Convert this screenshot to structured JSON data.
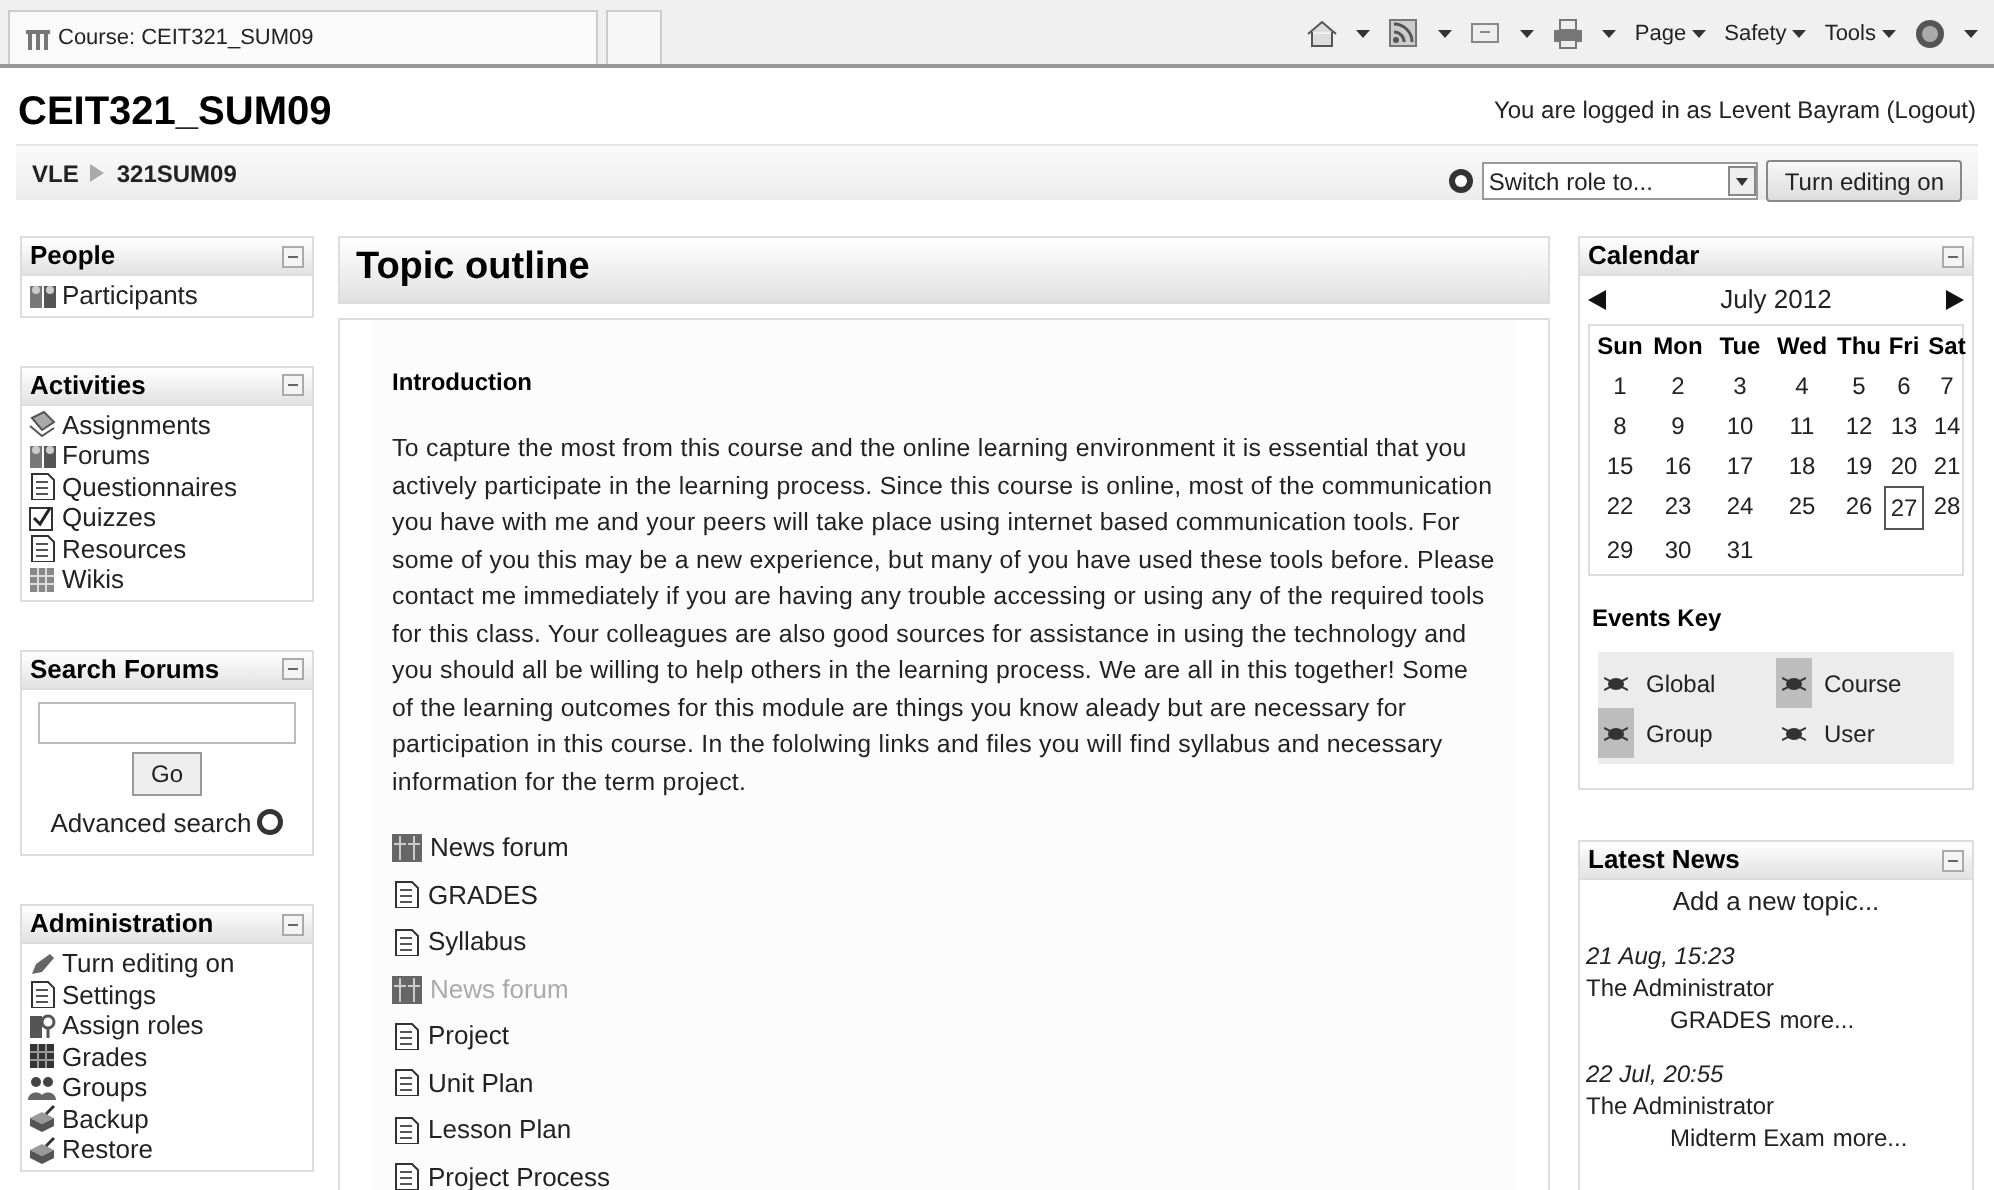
{
  "browser": {
    "tab_title": "Course: CEIT321_SUM09",
    "menus": [
      "Page",
      "Safety",
      "Tools"
    ]
  },
  "header": {
    "title": "CEIT321_SUM09",
    "login_text": "You are logged in as Levent Bayram",
    "logout": "(Logout)"
  },
  "breadcrumb": {
    "items": [
      "VLE",
      "321SUM09"
    ],
    "switch_role": {
      "value": "Switch role to..."
    },
    "edit_button": "Turn editing on"
  },
  "left_blocks": [
    {
      "kind": "links",
      "title": "People",
      "items": [
        "Participants"
      ]
    },
    {
      "kind": "links",
      "title": "Activities",
      "items": [
        "Assignments",
        "Forums",
        "Questionnaires",
        "Quizzes",
        "Resources",
        "Wikis"
      ]
    },
    {
      "kind": "search",
      "title": "Search Forums",
      "button": "Go",
      "link": "Advanced search"
    },
    {
      "kind": "links",
      "title": "Administration",
      "items": [
        "Turn editing on",
        "Settings",
        "Assign roles",
        "Grades",
        "Groups",
        "Backup",
        "Restore"
      ]
    }
  ],
  "topic": {
    "title": "Topic outline",
    "section_title": "Introduction",
    "text": "To capture the most from this course and the online learning environment it is essential that you actively participate in the learning process. Since this course is online, most of the communication you have with me and your peers will take place using internet based communication tools.  For some of you this may be a new experience, but many of you have used these tools before. Please contact me immediately if you are having any trouble accessing or using any of the required tools for this class. Your colleagues are also good sources for assistance in using the technology and you should all be willing to help others in the learning process. We are all in this together! Some of the learning outcomes for this module are things you know aleady but are necessary for participation in this course. In the fololwing links and files you will find syllabus and necessary information for the term project.",
    "resources": [
      {
        "kind": "forum",
        "label": "News forum",
        "hidden": false
      },
      {
        "kind": "file",
        "label": "GRADES",
        "hidden": false
      },
      {
        "kind": "file",
        "label": "Syllabus",
        "hidden": false
      },
      {
        "kind": "forum",
        "label": "News forum",
        "hidden": true
      },
      {
        "kind": "file",
        "label": "Project",
        "hidden": false
      },
      {
        "kind": "file",
        "label": "Unit Plan",
        "hidden": false
      },
      {
        "kind": "file",
        "label": "Lesson Plan",
        "hidden": false
      },
      {
        "kind": "file",
        "label": "Project Process",
        "hidden": false
      }
    ]
  },
  "calendar": {
    "title": "Calendar",
    "month": "July 2012",
    "weekdays": [
      "Sun",
      "Mon",
      "Tue",
      "Wed",
      "Thu",
      "Fri",
      "Sat"
    ],
    "weeks": [
      [
        {
          "day": "1",
          "today": false
        },
        {
          "day": "2",
          "today": false
        },
        {
          "day": "3",
          "today": false
        },
        {
          "day": "4",
          "today": false
        },
        {
          "day": "5",
          "today": false
        },
        {
          "day": "6",
          "today": false
        },
        {
          "day": "7",
          "today": false
        }
      ],
      [
        {
          "day": "8",
          "today": false
        },
        {
          "day": "9",
          "today": false
        },
        {
          "day": "10",
          "today": false
        },
        {
          "day": "11",
          "today": false
        },
        {
          "day": "12",
          "today": false
        },
        {
          "day": "13",
          "today": false
        },
        {
          "day": "14",
          "today": false
        }
      ],
      [
        {
          "day": "15",
          "today": false
        },
        {
          "day": "16",
          "today": false
        },
        {
          "day": "17",
          "today": false
        },
        {
          "day": "18",
          "today": false
        },
        {
          "day": "19",
          "today": false
        },
        {
          "day": "20",
          "today": false
        },
        {
          "day": "21",
          "today": false
        }
      ],
      [
        {
          "day": "22",
          "today": false
        },
        {
          "day": "23",
          "today": false
        },
        {
          "day": "24",
          "today": false
        },
        {
          "day": "25",
          "today": false
        },
        {
          "day": "26",
          "today": false
        },
        {
          "day": "27",
          "today": true
        },
        {
          "day": "28",
          "today": false
        }
      ],
      [
        {
          "day": "29",
          "today": false
        },
        {
          "day": "30",
          "today": false
        },
        {
          "day": "31",
          "today": false
        }
      ]
    ],
    "events_key_title": "Events Key",
    "events_key": [
      {
        "label": "Global",
        "highlighted": false
      },
      {
        "label": "Course",
        "highlighted": true
      },
      {
        "label": "Group",
        "highlighted": true
      },
      {
        "label": "User",
        "highlighted": false
      }
    ]
  },
  "latest_news": {
    "title": "Latest News",
    "add_link": "Add a new topic...",
    "posts": [
      {
        "time": "21 Aug, 15:23",
        "author": "The Administrator",
        "subject": "GRADES",
        "more": "more..."
      },
      {
        "time": "22 Jul, 20:55",
        "author": "The Administrator",
        "subject": "Midterm Exam",
        "more": "more..."
      }
    ]
  }
}
